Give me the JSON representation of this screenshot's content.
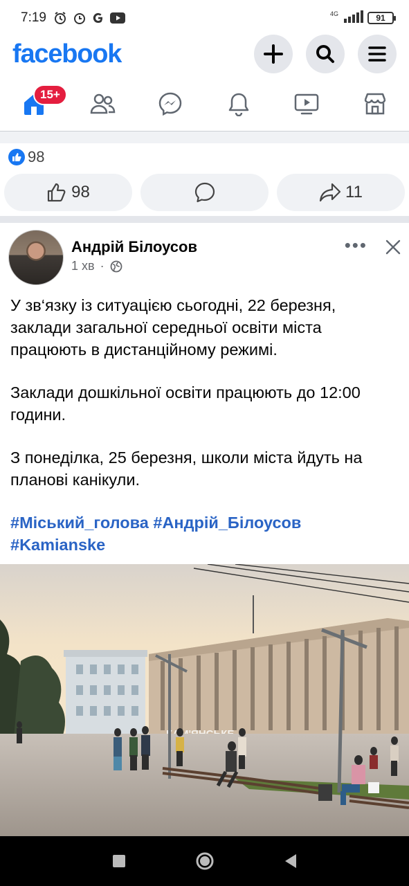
{
  "status_bar": {
    "time": "7:19",
    "network": "4G",
    "battery": "91"
  },
  "header": {
    "logo": "facebook"
  },
  "nav": {
    "home_badge": "15+"
  },
  "reactions": {
    "count": "98"
  },
  "actions": {
    "like_count": "98",
    "share_count": "11"
  },
  "post": {
    "author": "Андрій Білоусов",
    "time": "1 хв",
    "paragraphs": [
      "У зв‘язку із ситуацією сьогодні, 22 березня, заклади загальної середньої освіти міста працюють в дистанційному режимі.",
      "Заклади  дошкільної освіти працюють до 12:00 години.",
      "З понеділка, 25 березня, школи міста йдуть на планові канікули."
    ],
    "hashtags": "#Міський_голова #Андрій_Білоусов #Kamianske"
  },
  "photo": {
    "sign_text": "КАМ'ЯНСЬКЕ"
  },
  "colors": {
    "brand": "#1877f2",
    "hashtag": "#2a64c5",
    "badge": "#e41e3f"
  }
}
